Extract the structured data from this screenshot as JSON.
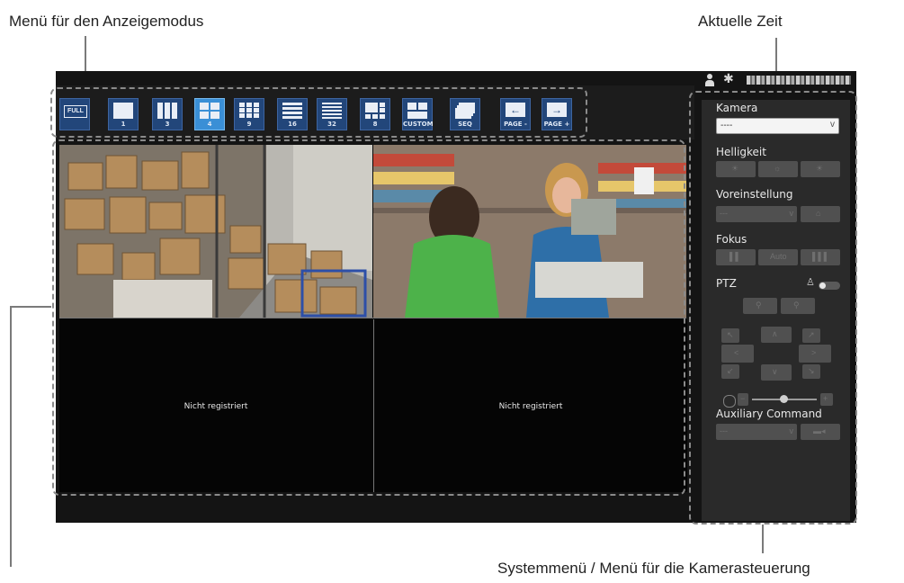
{
  "callouts": {
    "display_mode_menu": "Menü für den Anzeigemodus",
    "current_time": "Aktuelle Zeit",
    "system_camera_menu": "Systemmenü / Menü für die Kamerasteuerung"
  },
  "toolbar": {
    "modes": [
      {
        "label": "FULL",
        "icon": "fullscreen-icon"
      },
      {
        "label": "1",
        "icon": "layout-1-icon"
      },
      {
        "label": "3",
        "icon": "layout-3-icon"
      },
      {
        "label": "4",
        "icon": "layout-4-icon",
        "active": true
      },
      {
        "label": "9",
        "icon": "layout-9-icon"
      },
      {
        "label": "16",
        "icon": "layout-16-icon"
      },
      {
        "label": "32",
        "icon": "layout-32-icon"
      },
      {
        "label": "8",
        "icon": "layout-8-icon"
      },
      {
        "label": "CUSTOM",
        "icon": "layout-custom-icon"
      },
      {
        "label": "SEQ",
        "icon": "sequence-icon"
      },
      {
        "label": "PAGE -",
        "icon": "arrow-left-icon"
      },
      {
        "label": "PAGE +",
        "icon": "arrow-right-icon"
      }
    ]
  },
  "tiles": {
    "empty_label": "Nicht registriert"
  },
  "side_menu": {
    "camera_label": "Kamera",
    "camera_value": "----",
    "brightness_label": "Helligkeit",
    "preset_label": "Voreinstellung",
    "preset_value": "---",
    "focus_label": "Fokus",
    "focus_auto": "Auto",
    "ptz_label": "PTZ",
    "aux_label": "Auxiliary Command",
    "aux_value": "---"
  },
  "colors": {
    "active_mode": "#3a8fd6",
    "mode_button": "#22467a",
    "panel": "#2a2a2a"
  }
}
